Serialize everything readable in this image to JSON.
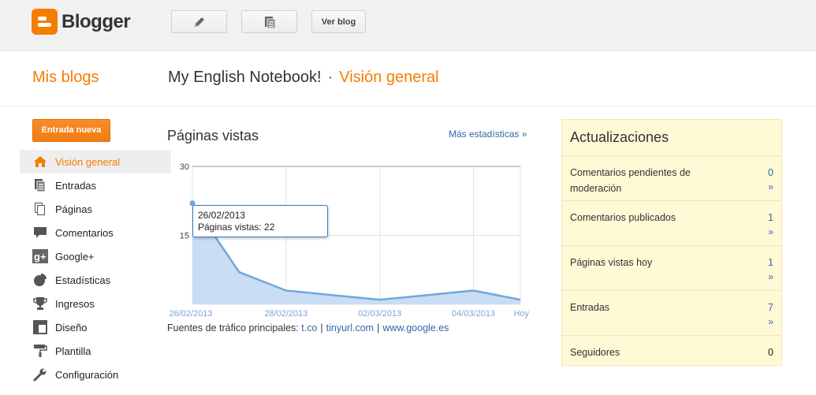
{
  "app": {
    "name": "Blogger"
  },
  "toolbar": {
    "view_blog": "Ver blog"
  },
  "header": {
    "my_blogs": "Mis blogs",
    "blog_title": "My English Notebook!",
    "separator": "·",
    "section": "Visión general"
  },
  "sidebar": {
    "new_post": "Entrada nueva",
    "items": [
      {
        "label": "Visión general",
        "icon": "home-icon"
      },
      {
        "label": "Entradas",
        "icon": "posts-icon"
      },
      {
        "label": "Páginas",
        "icon": "pages-icon"
      },
      {
        "label": "Comentarios",
        "icon": "comment-icon"
      },
      {
        "label": "Google+",
        "icon": "google-plus-icon"
      },
      {
        "label": "Estadísticas",
        "icon": "pie-chart-icon"
      },
      {
        "label": "Ingresos",
        "icon": "trophy-icon"
      },
      {
        "label": "Diseño",
        "icon": "layout-icon"
      },
      {
        "label": "Plantilla",
        "icon": "paint-roller-icon"
      },
      {
        "label": "Configuración",
        "icon": "wrench-icon"
      }
    ]
  },
  "stats": {
    "title": "Páginas vistas",
    "more_link": "Más estadísticas »",
    "tooltip_date": "26/02/2013",
    "tooltip_text": "Páginas vistas: 22",
    "traffic_label": "Fuentes de tráfico principales:",
    "traffic_sources": [
      "t.co",
      "tinyurl.com",
      "www.google.es"
    ]
  },
  "chart_data": {
    "type": "area",
    "x": [
      "26/02/2013",
      "27/02/2013",
      "28/02/2013",
      "01/03/2013",
      "02/03/2013",
      "03/03/2013",
      "04/03/2013",
      "Hoy"
    ],
    "series": [
      {
        "values": [
          22,
          7,
          3,
          2,
          1,
          2,
          3,
          1
        ]
      }
    ],
    "x_tick_labels": [
      "26/02/2013",
      "28/02/2013",
      "02/03/2013",
      "04/03/2013",
      "Hoy"
    ],
    "y_tick_labels": [
      "30",
      "15"
    ],
    "ylim": [
      0,
      30
    ],
    "grid": true,
    "colors": {
      "line": "#6fa8dc",
      "fill": "#c9ddf4",
      "tick_text": "#7aa6d6"
    }
  },
  "updates": {
    "title": "Actualizaciones",
    "rows": [
      {
        "label": "Comentarios pendientes de moderación",
        "value": "0",
        "arrow": "»"
      },
      {
        "label": "Comentarios publicados",
        "value": "1",
        "arrow": "»"
      },
      {
        "label": "Páginas vistas hoy",
        "value": "1",
        "arrow": "»"
      },
      {
        "label": "Entradas",
        "value": "7",
        "arrow": "»"
      },
      {
        "label": "Seguidores",
        "value": "0",
        "arrow": ""
      }
    ]
  },
  "colors": {
    "accent": "#f57d00",
    "link": "#3366aa",
    "panel_bg": "#fff9d6"
  }
}
